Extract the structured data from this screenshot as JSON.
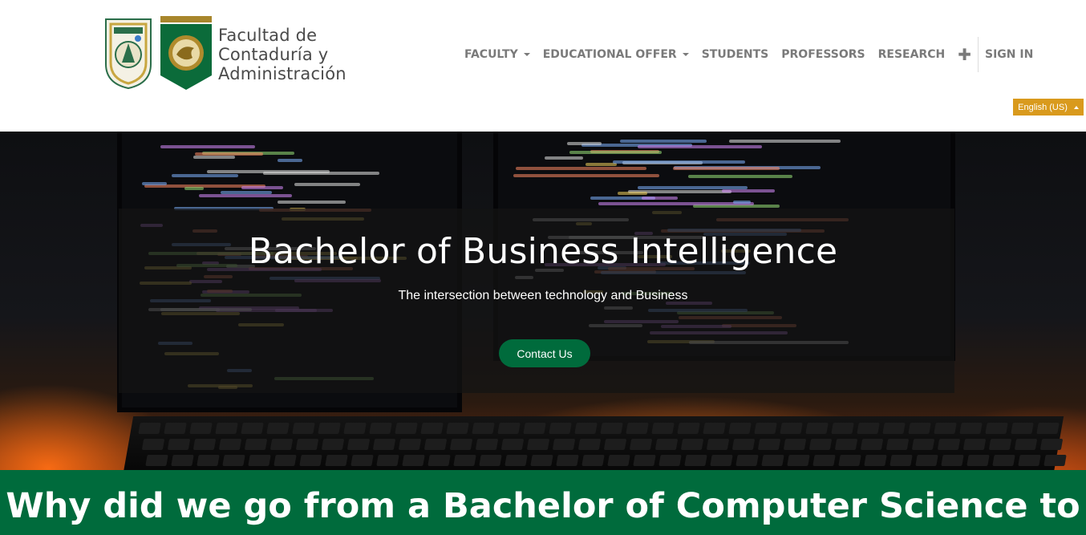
{
  "brand": {
    "line1": "Facultad de",
    "line2": "Contaduría y",
    "line3": "Administración"
  },
  "nav": {
    "items": [
      {
        "label": "FACULTY",
        "dropdown": true
      },
      {
        "label": "EDUCATIONAL OFFER",
        "dropdown": true
      },
      {
        "label": "STUDENTS",
        "dropdown": false
      },
      {
        "label": "PROFESSORS",
        "dropdown": false
      },
      {
        "label": "RESEARCH",
        "dropdown": false
      }
    ],
    "plus": "✚",
    "signin": "SIGN IN"
  },
  "language": {
    "label": "English (US)"
  },
  "hero": {
    "title": "Bachelor of Business Intelligence",
    "subtitle": "The intersection between technology and Business",
    "cta": "Contact Us"
  },
  "band": {
    "title": "Why did we go from a Bachelor of Computer Science to"
  },
  "colors": {
    "green": "#006b3c",
    "gold": "#d99a1d",
    "nav_text": "#7a7a7a"
  }
}
